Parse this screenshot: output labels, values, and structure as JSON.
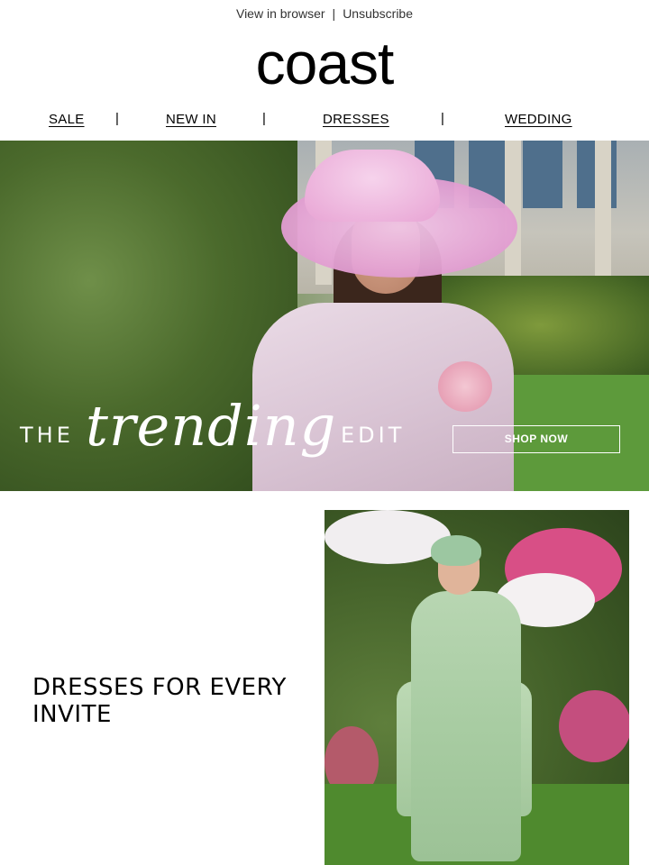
{
  "utility": {
    "view_in_browser": "View in browser",
    "separator": "|",
    "unsubscribe": "Unsubscribe"
  },
  "brand": {
    "logo": "coast"
  },
  "nav": {
    "items": [
      {
        "label": "SALE"
      },
      {
        "label": "NEW IN"
      },
      {
        "label": "DRESSES"
      },
      {
        "label": "WEDDING"
      }
    ],
    "separator": "|"
  },
  "hero": {
    "the": "THE",
    "trending": "trending",
    "edit": "EDIT",
    "cta": "SHOP NOW"
  },
  "section2": {
    "title": "DRESSES FOR EVERY INVITE"
  }
}
